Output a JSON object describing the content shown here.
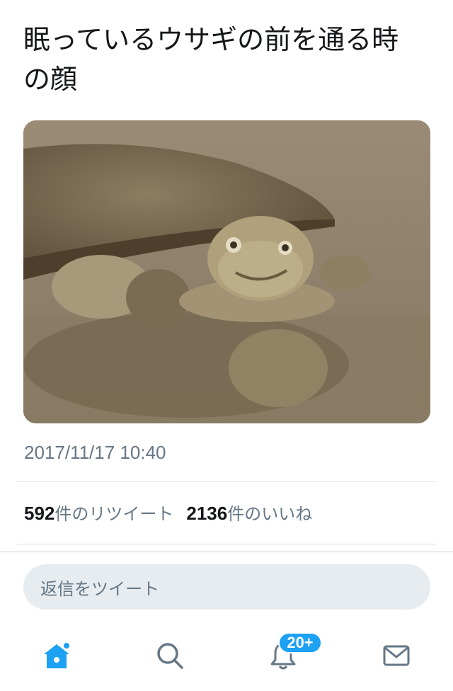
{
  "tweet": {
    "text": "眠っているウサギの前を通る時の顔",
    "image": {
      "subject": "turtle-photo",
      "colors": {
        "background": "#8b7d68",
        "shell": "#7a6a52",
        "water": "#968771"
      }
    },
    "timestamp": "2017/11/17 10:40",
    "retweets": {
      "count": "592",
      "label": "件のリツイート"
    },
    "likes": {
      "count": "2136",
      "label": "件のいいね"
    }
  },
  "reply": {
    "placeholder": "返信をツイート"
  },
  "tabbar": {
    "tabs": [
      {
        "name": "home",
        "icon": "home-icon",
        "active": true
      },
      {
        "name": "search",
        "icon": "search-icon",
        "active": false
      },
      {
        "name": "notifications",
        "icon": "bell-icon",
        "active": false,
        "badge": "20+"
      },
      {
        "name": "messages",
        "icon": "mail-icon",
        "active": false
      }
    ]
  },
  "colors": {
    "accent": "#1da1f2",
    "muted": "#657786",
    "text": "#14171a"
  }
}
